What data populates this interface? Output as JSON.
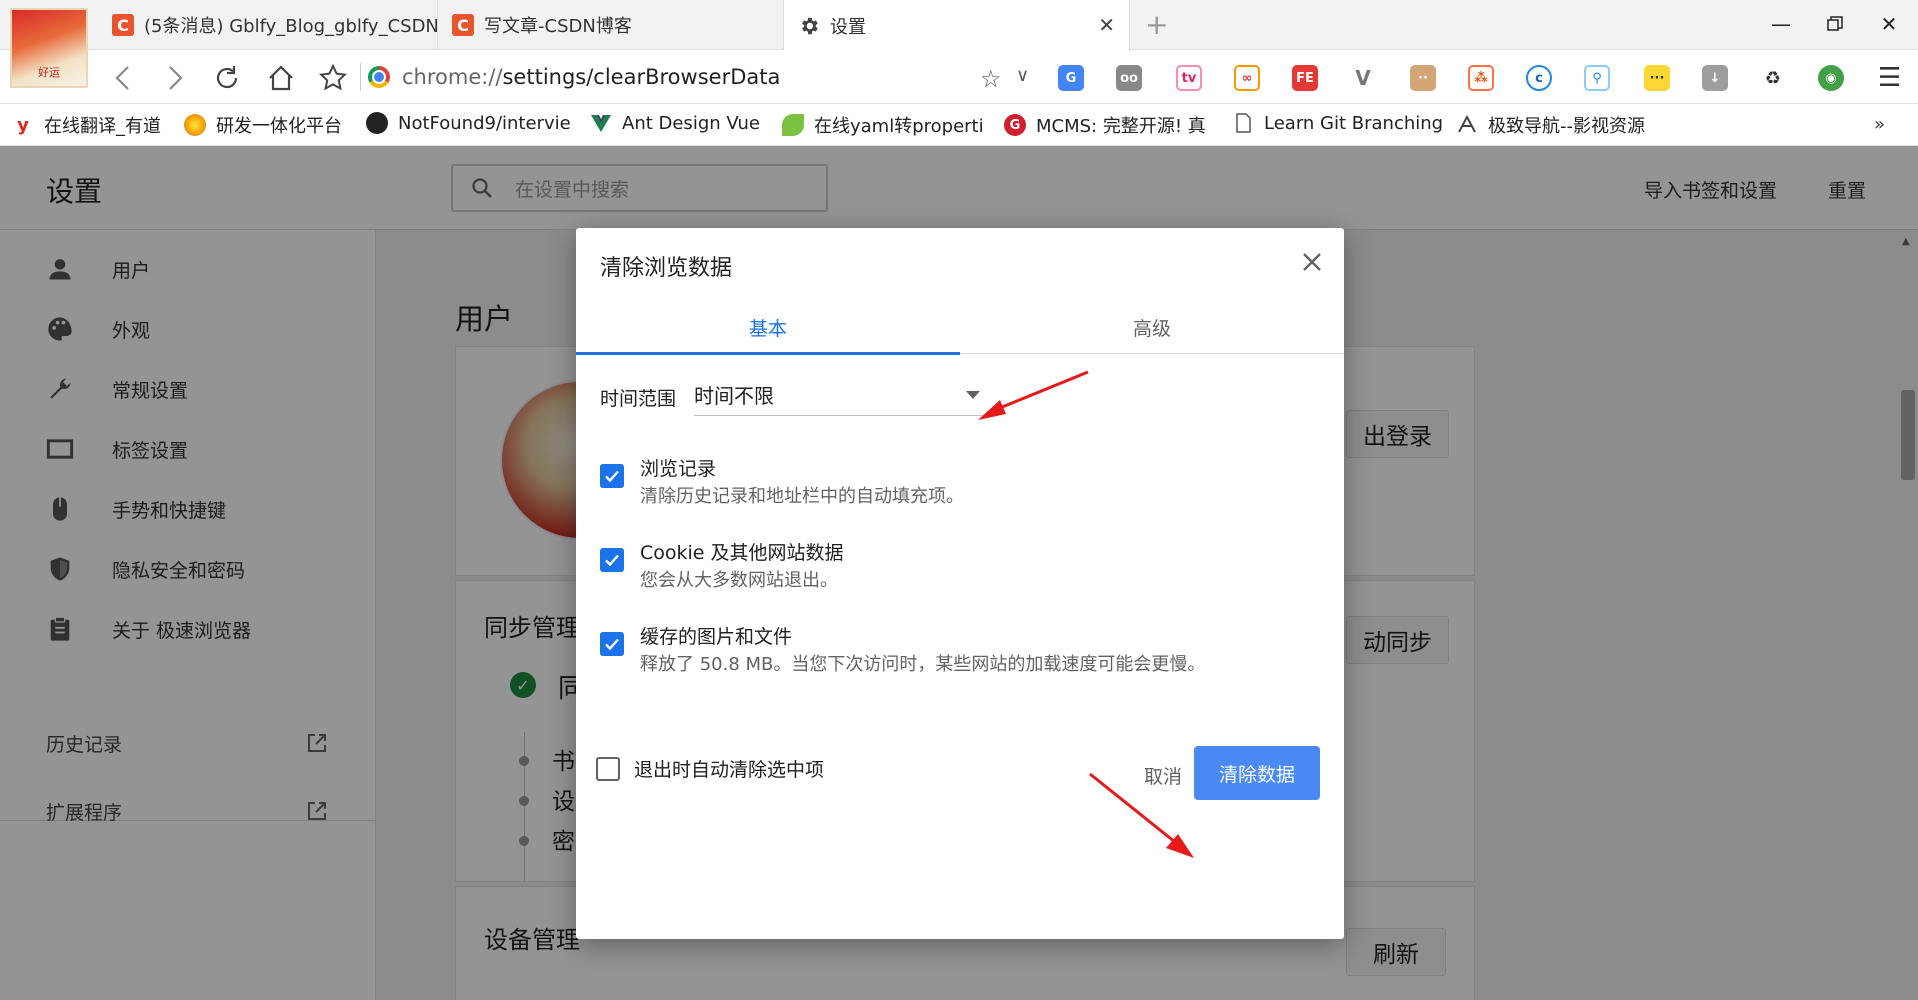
{
  "tabs": [
    {
      "title": "(5条消息) Gblfy_Blog_gblfy_CSDN",
      "favicon": "C"
    },
    {
      "title": "写文章-CSDN博客",
      "favicon": "C"
    },
    {
      "title": "设置",
      "favicon": "gear-icon",
      "close": "✕"
    }
  ],
  "toolbar": {
    "url_scheme": "chrome://",
    "url_rest": "settings/clearBrowserData"
  },
  "bookmarks": [
    {
      "label": "在线翻译_有道",
      "icon": "y",
      "color": "#e1251b"
    },
    {
      "label": "研发一体化平台",
      "icon": "",
      "color": "#ff9800"
    },
    {
      "label": "NotFound9/intervie",
      "icon": "",
      "color": "#222222"
    },
    {
      "label": "Ant Design Vue",
      "icon": "",
      "color": "#1a7f4b"
    },
    {
      "label": "在线yaml转properti",
      "icon": "",
      "color": "#7cc242"
    },
    {
      "label": "MCMS: 完整开源! 真",
      "icon": "G",
      "color": "#d0202d"
    },
    {
      "label": "Learn Git Branching",
      "icon": "",
      "color": "#ffffff"
    },
    {
      "label": "极致导航--影视资源",
      "icon": "",
      "color": "#ffffff"
    }
  ],
  "bookmarks_more": "»",
  "settings": {
    "title": "设置",
    "search_placeholder": "在设置中搜索",
    "import_label": "导入书签和设置",
    "reset_label": "重置",
    "sidebar": [
      {
        "label": "用户",
        "icon": "person-icon"
      },
      {
        "label": "外观",
        "icon": "palette-icon"
      },
      {
        "label": "常规设置",
        "icon": "wrench-icon"
      },
      {
        "label": "标签设置",
        "icon": "tab-icon"
      },
      {
        "label": "手势和快捷键",
        "icon": "mouse-icon"
      },
      {
        "label": "隐私安全和密码",
        "icon": "shield-icon"
      },
      {
        "label": "关于 极速浏览器",
        "icon": "clipboard-icon"
      }
    ],
    "sidebar_links": [
      {
        "label": "历史记录"
      },
      {
        "label": "扩展程序"
      }
    ],
    "section_title": "用户",
    "signout_partial": "出登录",
    "sync_title_partial": "同步管理",
    "sync_button_partial": "动同步",
    "sync_status_partial": "同",
    "sync_items_partial": [
      "书",
      "设",
      "密"
    ],
    "device_title_partial": "设备管理",
    "refresh_label": "刷新"
  },
  "dialog": {
    "title": "清除浏览数据",
    "tabs": [
      {
        "label": "基本",
        "active": true
      },
      {
        "label": "高级",
        "active": false
      }
    ],
    "time_range_label": "时间范围",
    "time_range_value": "时间不限",
    "options": [
      {
        "title": "浏览记录",
        "desc": "清除历史记录和地址栏中的自动填充项。",
        "checked": true
      },
      {
        "title": "Cookie 及其他网站数据",
        "desc": "您会从大多数网站退出。",
        "checked": true
      },
      {
        "title": "缓存的图片和文件",
        "desc": "释放了 50.8 MB。当您下次访问时，某些网站的加载速度可能会更慢。",
        "checked": true
      }
    ],
    "auto_clear_label": "退出时自动清除选中项",
    "auto_clear_checked": false,
    "cancel_label": "取消",
    "clear_label": "清除数据"
  },
  "colors": {
    "accent": "#1a73e8",
    "primary_button": "#4a8af4",
    "annotation_arrow": "#e8191b"
  }
}
